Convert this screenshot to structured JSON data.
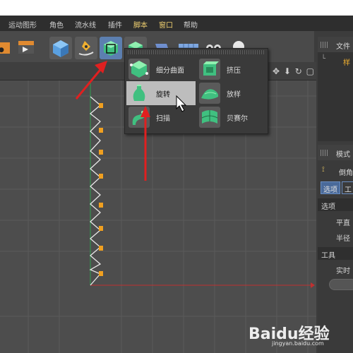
{
  "menubar": {
    "items": [
      "运动图形",
      "角色",
      "流水线",
      "插件",
      "脚本",
      "窗口",
      "帮助"
    ]
  },
  "toolbar": {
    "buttons": [
      {
        "name": "cube-icon"
      },
      {
        "name": "pen-spline-icon"
      },
      {
        "name": "generator-nurbs-icon",
        "selected": true
      },
      {
        "name": "deformer-icon"
      },
      {
        "name": "environment-icon"
      },
      {
        "name": "camera-icon"
      },
      {
        "name": "light-icon"
      }
    ]
  },
  "dropdown": {
    "items": [
      {
        "label": "细分曲面",
        "icon": "subdivision-surface-icon"
      },
      {
        "label": "挤压",
        "icon": "extrude-icon"
      },
      {
        "label": "旋转",
        "icon": "lathe-icon",
        "hover": true
      },
      {
        "label": "放样",
        "icon": "loft-icon"
      },
      {
        "label": "扫描",
        "icon": "sweep-icon"
      },
      {
        "label": "贝赛尔",
        "icon": "bezier-icon"
      }
    ]
  },
  "objects_panel": {
    "header": "文件",
    "item": "样"
  },
  "attributes_panel": {
    "header": "模式",
    "object_name": "倒角",
    "tabs": [
      "选项",
      "工"
    ],
    "section1": "选项",
    "rows": [
      "平直",
      "半径"
    ],
    "section2": "工具",
    "realtime": "实时"
  },
  "watermark": {
    "brand": "Baidu经验",
    "url": "jingyan.baidu.com"
  },
  "colors": {
    "accent": "#5c7fb0",
    "arrow": "#e02020",
    "point": "#f0a020",
    "axis_x": "#c03030",
    "axis_y": "#30a050"
  }
}
